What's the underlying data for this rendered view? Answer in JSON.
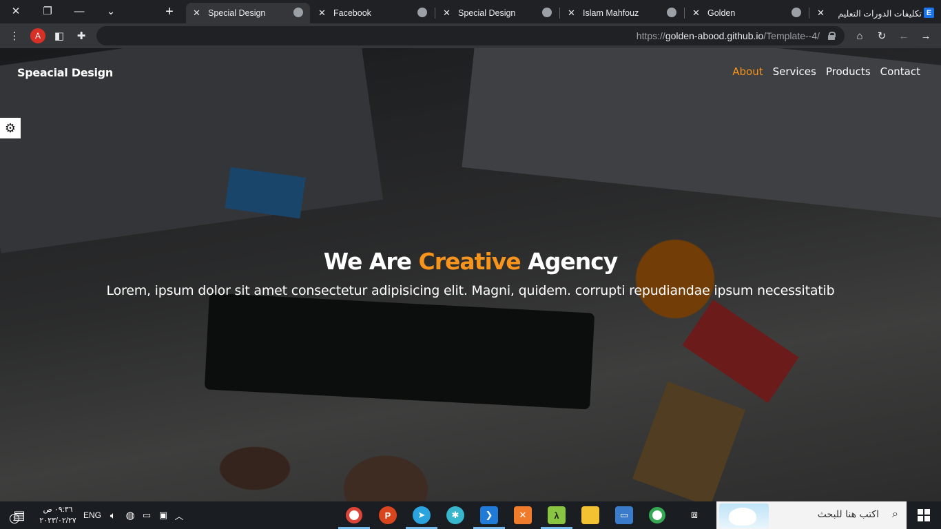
{
  "browser": {
    "tabs": [
      {
        "label": "Special Design",
        "active": true
      },
      {
        "label": "Facebook",
        "active": false
      },
      {
        "label": "Special Design",
        "active": false
      },
      {
        "label": "Islam Mahfouz",
        "active": false
      },
      {
        "label": "Golden",
        "active": false
      },
      {
        "label": "تكليفات الدورات التعليم",
        "active": false
      }
    ],
    "profile_initial": "A",
    "url_prefix": "https://",
    "url_host": "golden-abood.github.io",
    "url_path": "/Template--4/"
  },
  "site": {
    "logo": "Speacial Design",
    "nav": [
      {
        "label": "About",
        "current": true
      },
      {
        "label": "Services",
        "current": false
      },
      {
        "label": "Products",
        "current": false
      },
      {
        "label": "Contact",
        "current": false
      }
    ],
    "hero": {
      "title_part1": "We Are",
      "title_accent": "Creative",
      "title_part2": "Agency",
      "subtitle": "Lorem, ipsum dolor sit amet consectetur adipisicing elit. Magni, quidem. corrupti repudiandae ipsum necessitatib"
    },
    "colors": {
      "accent": "#f7941d",
      "text": "#ffffff"
    }
  },
  "taskbar": {
    "time": "٠٩:٣٦ ص",
    "date": "٢٠٢٣/٠٢/٢٧",
    "notification_count": "1",
    "language": "ENG",
    "search_placeholder": "اكتب هنا للبحث"
  }
}
